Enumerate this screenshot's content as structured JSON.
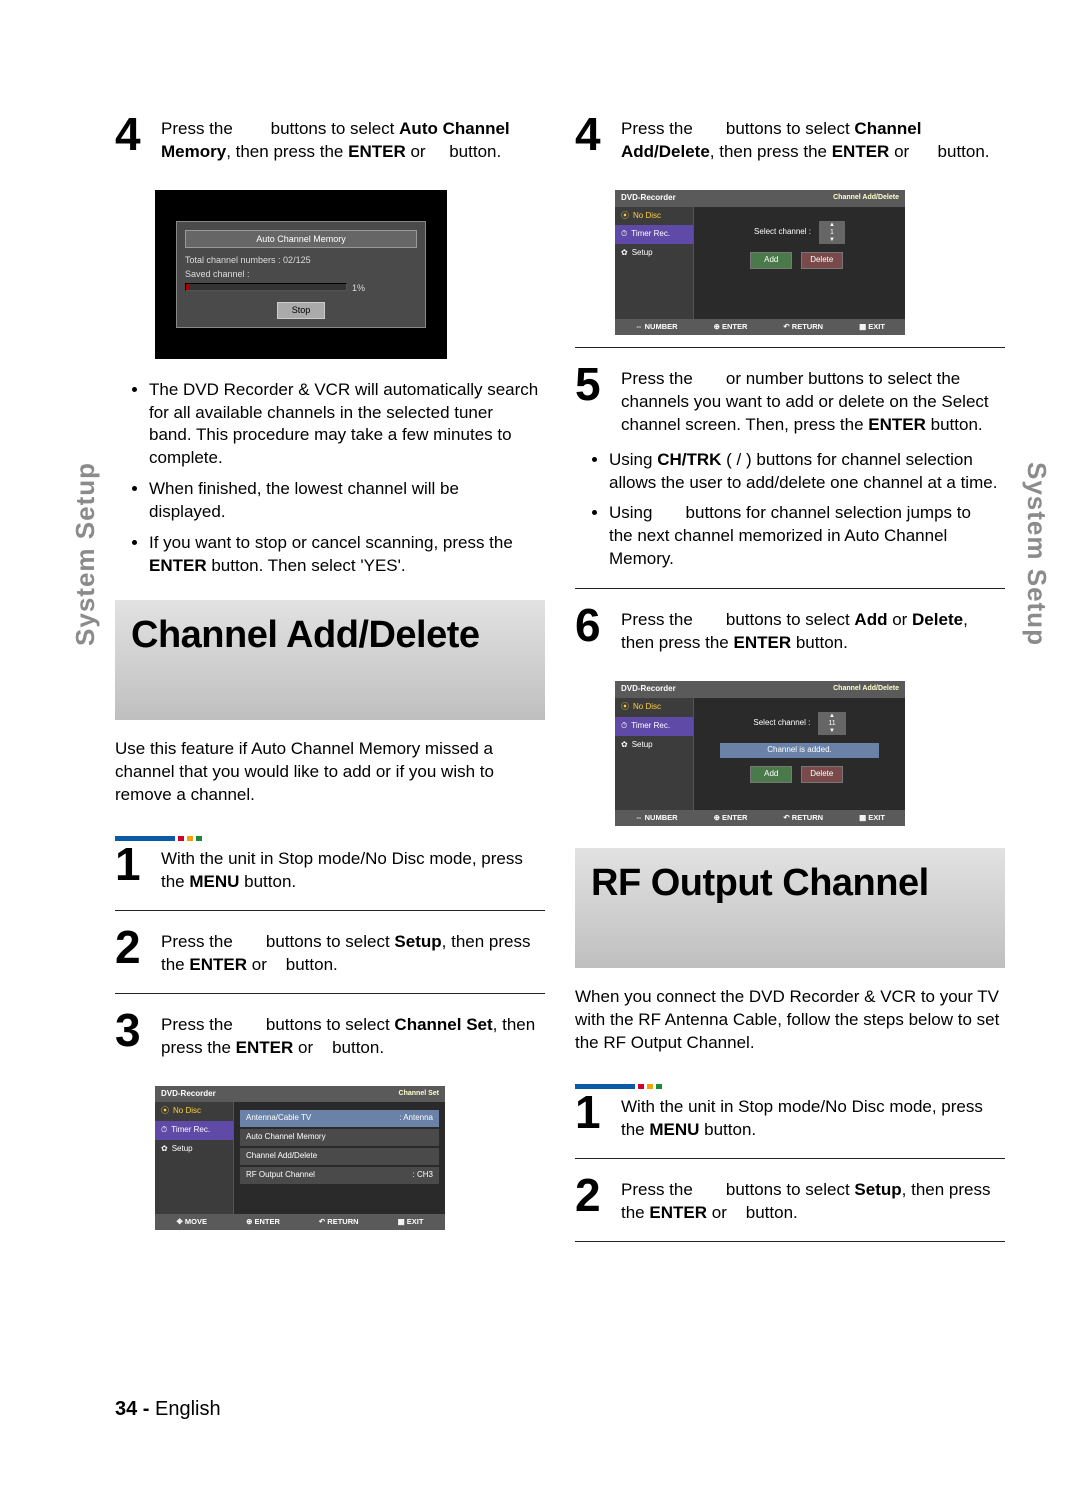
{
  "tab": "System Setup",
  "footer": {
    "page": "34 -",
    "lang": "English"
  },
  "left": {
    "step4": {
      "num": "4",
      "pre": "Press the",
      "mid1": "buttons to select",
      "bold1": "Auto Channel Memory",
      "mid2": ", then press the",
      "bold2": "ENTER",
      "mid3": "or",
      "post": "button."
    },
    "osd1": {
      "title": "Auto Channel Memory",
      "row1": "Total channel numbers : 02/125",
      "row2": "Saved channel :",
      "pct": "1%",
      "stop": "Stop"
    },
    "bullets1": [
      "The DVD Recorder & VCR will automatically search for all available channels in the selected tuner band. This procedure may take a few minutes to complete.",
      "When finished, the lowest channel will be displayed."
    ],
    "bullet_cancel_pre": "If you want to stop or cancel scanning, press the ",
    "bullet_cancel_bold": "ENTER",
    "bullet_cancel_post": " button. Then select 'YES'.",
    "heading1": "Channel Add/Delete",
    "intro1": "Use this feature if Auto Channel Memory missed a channel that you would like to add or if you wish to remove a channel.",
    "step1": {
      "num": "1",
      "pre": "With the unit in Stop mode/No Disc mode, press the ",
      "bold": "MENU",
      "post": " button."
    },
    "step2": {
      "num": "2",
      "pre": "Press the",
      "mid1": "buttons to select",
      "bold1": "Setup",
      "mid2": ", then press the",
      "bold2": "ENTER",
      "mid3": "or",
      "post": "button."
    },
    "step3": {
      "num": "3",
      "pre": "Press the",
      "mid1": "buttons to select",
      "bold1": "Channel Set",
      "mid2": ", then press the",
      "bold2": "ENTER",
      "mid3": "or",
      "post": "button."
    },
    "osd3": {
      "app": "DVD-Recorder",
      "screen": "Channel Set",
      "side": {
        "nodisc": "No Disc",
        "timer": "Timer Rec.",
        "setup": "Setup"
      },
      "rows": [
        {
          "label": "Antenna/Cable TV",
          "value": ": Antenna",
          "hl": true
        },
        {
          "label": "Auto Channel Memory",
          "value": ""
        },
        {
          "label": "Channel Add/Delete",
          "value": ""
        },
        {
          "label": "RF Output Channel",
          "value": "  : CH3"
        }
      ],
      "foot": [
        "MOVE",
        "ENTER",
        "RETURN",
        "EXIT"
      ]
    }
  },
  "right": {
    "step4": {
      "num": "4",
      "pre": "Press the",
      "mid1": "buttons to select",
      "bold1": "Channel Add/Delete",
      "mid2": ", then press the",
      "bold2": "ENTER",
      "mid3": "or",
      "post": "button."
    },
    "osd4": {
      "app": "DVD-Recorder",
      "screen": "Channel Add/Delete",
      "side": {
        "nodisc": "No Disc",
        "timer": "Timer Rec.",
        "setup": "Setup"
      },
      "selLabel": "Select channel    :",
      "selVal": "1",
      "add": "Add",
      "del": "Delete",
      "foot": [
        "NUMBER",
        "ENTER",
        "RETURN",
        "EXIT"
      ]
    },
    "step5": {
      "num": "5",
      "pre": "Press the",
      "mid": "or number buttons to select the channels you want to add or delete on the Select channel screen. Then, press the",
      "bold": "ENTER",
      "post": " button."
    },
    "bullets5a_pre": "Using ",
    "bullets5a_bold": "CH/TRK",
    "bullets5a_sym": " (   /   ) ",
    "bullets5a_post": "buttons for channel selection allows the user to add/delete one channel at a time.",
    "bullets5b_pre": "Using",
    "bullets5b_post": "buttons for channel selection jumps to the next channel memorized in Auto Channel Memory.",
    "step6": {
      "num": "6",
      "pre": "Press the",
      "mid": "buttons to select",
      "bold1": "Add",
      "or": " or ",
      "bold2": "Delete",
      "mid2": ", then press the",
      "bold3": "ENTER",
      "post": " button."
    },
    "osd6": {
      "app": "DVD-Recorder",
      "screen": "Channel Add/Delete",
      "side": {
        "nodisc": "No Disc",
        "timer": "Timer Rec.",
        "setup": "Setup"
      },
      "selLabel": "Select channel    :",
      "selVal": "11",
      "addedMsg": "Channel is added.",
      "add": "Add",
      "del": "Delete",
      "foot": [
        "NUMBER",
        "ENTER",
        "RETURN",
        "EXIT"
      ]
    },
    "heading2": "RF Output Channel",
    "intro2": "When you connect the DVD Recorder & VCR to your TV with the RF Antenna Cable, follow the steps below to set the RF Output Channel.",
    "step1b": {
      "num": "1",
      "pre": "With the unit in Stop mode/No Disc mode, press the ",
      "bold": "MENU",
      "post": " button."
    },
    "step2b": {
      "num": "2",
      "pre": "Press the",
      "mid1": "buttons to select",
      "bold1": "Setup",
      "mid2": ", then press the",
      "bold2": "ENTER",
      "mid3": "or",
      "post": "button."
    }
  }
}
